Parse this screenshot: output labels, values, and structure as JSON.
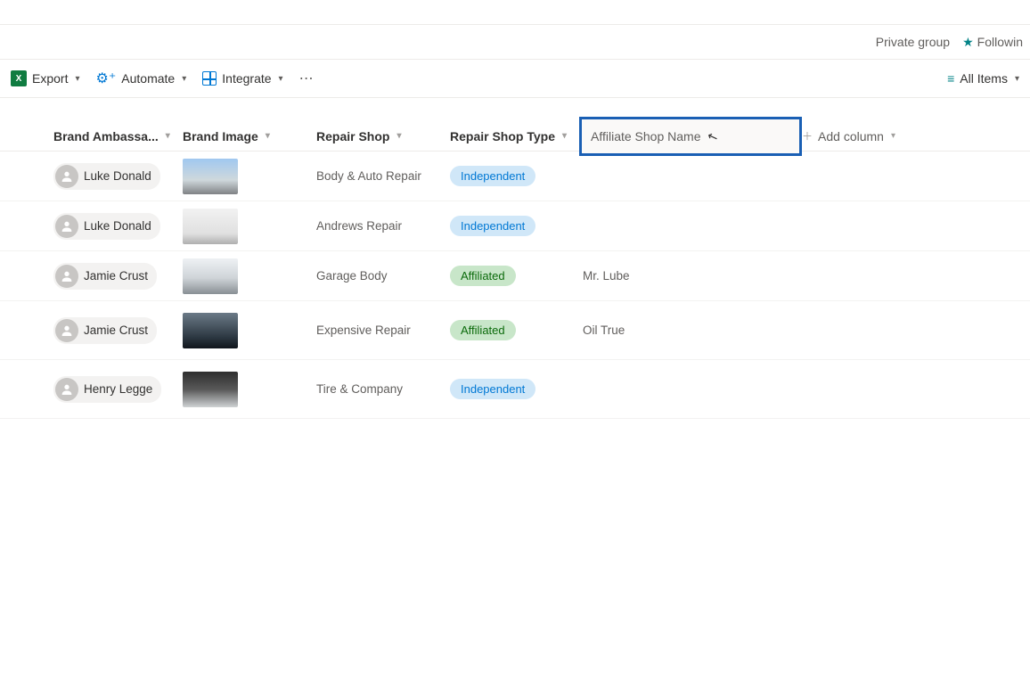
{
  "header": {
    "private_group": "Private group",
    "following": "Followin"
  },
  "toolbar": {
    "export": "Export",
    "automate": "Automate",
    "integrate": "Integrate",
    "all_items": "All Items"
  },
  "columns": {
    "brand_ambassador": "Brand Ambassa...",
    "brand_image": "Brand Image",
    "repair_shop": "Repair Shop",
    "repair_shop_type": "Repair Shop Type",
    "affiliate_shop_name": "Affiliate Shop Name",
    "add_column": "Add column"
  },
  "rows": [
    {
      "ambassador": "Luke Donald",
      "thumb": "blue",
      "repair_shop": "Body & Auto Repair",
      "type": "Independent",
      "type_class": "independent",
      "affiliate": ""
    },
    {
      "ambassador": "Luke Donald",
      "thumb": "silver",
      "repair_shop": "Andrews Repair",
      "type": "Independent",
      "type_class": "independent",
      "affiliate": ""
    },
    {
      "ambassador": "Jamie Crust",
      "thumb": "grey",
      "repair_shop": "Garage Body",
      "type": "Affiliated",
      "type_class": "affiliated",
      "affiliate": "Mr. Lube"
    },
    {
      "ambassador": "Jamie Crust",
      "thumb": "dark",
      "repair_shop": "Expensive Repair",
      "type": "Affiliated",
      "type_class": "affiliated",
      "affiliate": "Oil True"
    },
    {
      "ambassador": "Henry Legge",
      "thumb": "night",
      "repair_shop": "Tire & Company",
      "type": "Independent",
      "type_class": "independent",
      "affiliate": ""
    }
  ]
}
